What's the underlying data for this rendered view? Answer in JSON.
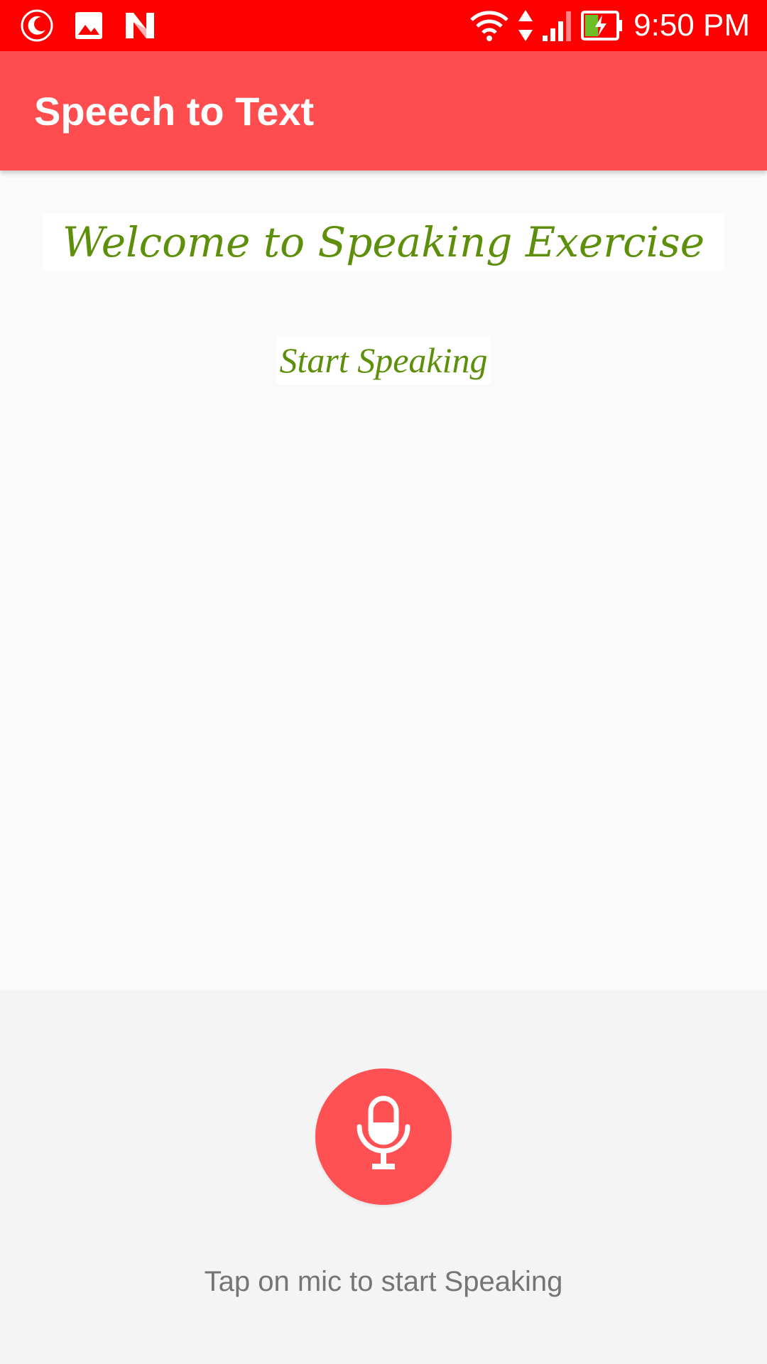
{
  "status_bar": {
    "time": "9:50 PM",
    "left_icons": [
      "night-mode-icon",
      "image-icon",
      "n-logo-icon"
    ],
    "right_icons": [
      "wifi-icon",
      "data-arrows-icon",
      "signal-icon",
      "battery-charging-icon"
    ],
    "background_color": "#ff0000"
  },
  "app_bar": {
    "title": "Speech to Text",
    "background_color": "#ff4d4f"
  },
  "main": {
    "welcome_text": "Welcome to Speaking Exercise",
    "start_speaking_text": "Start Speaking",
    "text_color": "#5e8f0a"
  },
  "bottom": {
    "mic_icon": "microphone-icon",
    "mic_color": "#ff5054",
    "hint": "Tap on mic to start Speaking"
  }
}
